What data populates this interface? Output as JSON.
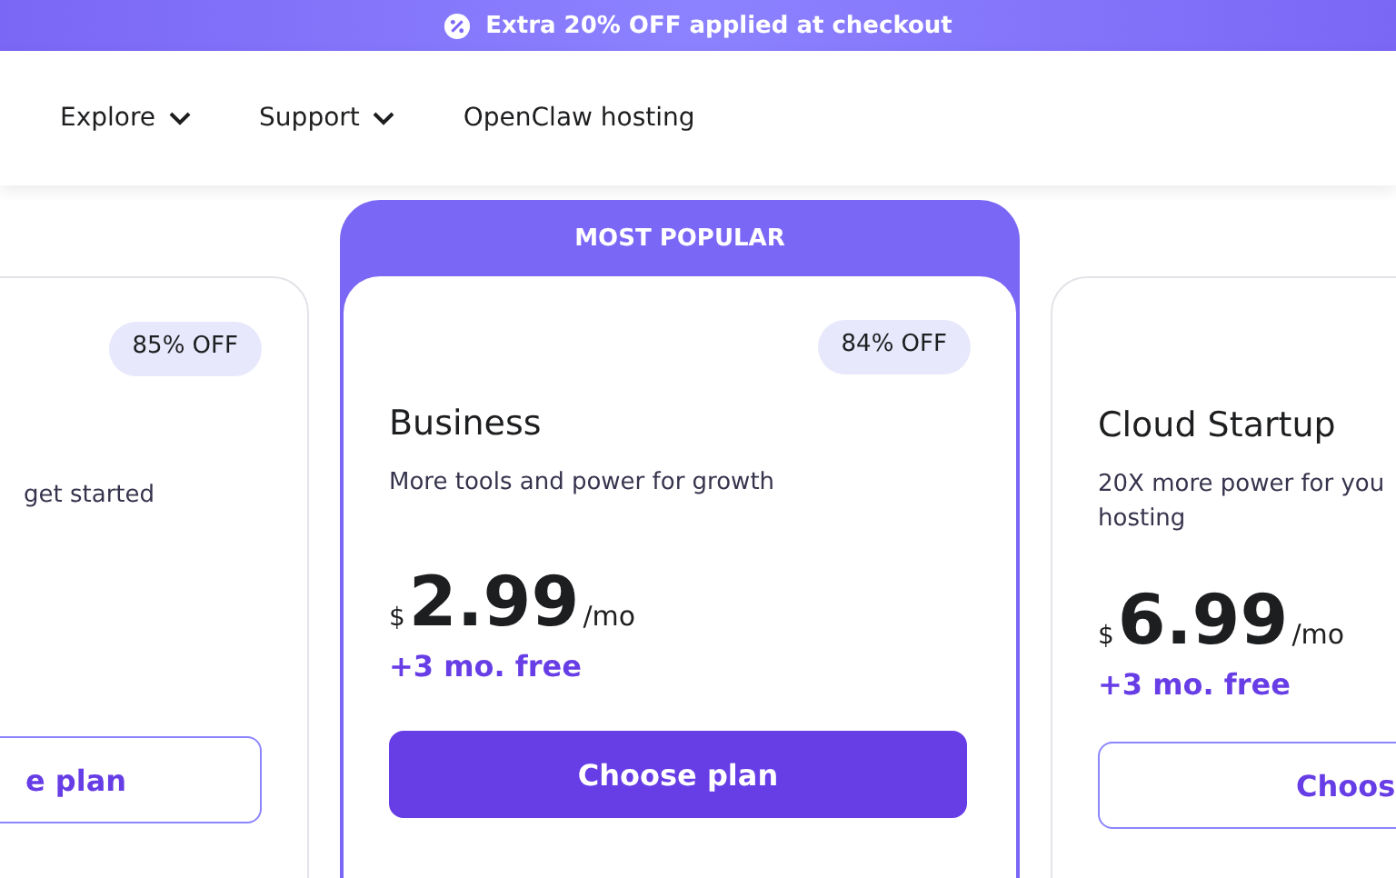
{
  "promo_banner": {
    "text": "Extra 20% OFF applied at checkout"
  },
  "nav": [
    {
      "label": "Explore",
      "dropdown": true
    },
    {
      "label": "Support",
      "dropdown": true
    },
    {
      "label": "OpenClaw hosting",
      "dropdown": false
    }
  ],
  "plans": [
    {
      "kind": "cut-left",
      "badge": "85% OFF",
      "description_lines": [
        "get started"
      ],
      "button": "e plan",
      "highlighted": false
    },
    {
      "kind": "full",
      "ribbon": "MOST POPULAR",
      "badge": "84% OFF",
      "name": "Business",
      "description_lines": [
        "More tools and power for growth"
      ],
      "currency": "$",
      "price": "2.99",
      "period": "/mo",
      "bonus": "+3 mo. free",
      "button": "Choose plan",
      "highlighted": true
    },
    {
      "kind": "cut-right",
      "name": "Cloud Startup",
      "description_lines": [
        "20X more power for you",
        "hosting"
      ],
      "currency": "$",
      "price": "6.99",
      "period": "/mo",
      "bonus": "+3 mo. free",
      "button": "Choos",
      "highlighted": false
    }
  ]
}
